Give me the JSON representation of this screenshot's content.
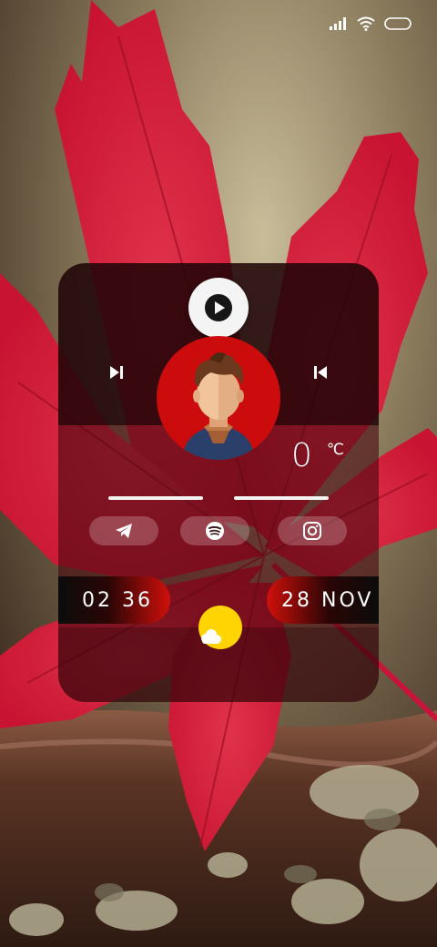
{
  "status_bar": {
    "icons": [
      "signal-icon",
      "wifi-icon",
      "battery-icon"
    ]
  },
  "music": {
    "play_icon": "play-icon",
    "next_icon": "skip-next-icon",
    "prev_icon": "skip-previous-icon"
  },
  "weather": {
    "temperature": "0",
    "unit": "℃",
    "icon": "sun-cloud-icon"
  },
  "social": [
    {
      "name": "telegram",
      "icon": "telegram-icon"
    },
    {
      "name": "spotify",
      "icon": "spotify-icon"
    },
    {
      "name": "instagram",
      "icon": "instagram-icon"
    }
  ],
  "clock": {
    "time": "02 36",
    "date": "28 NOV"
  },
  "colors": {
    "accent_red": "#cc0c0c",
    "sun_yellow": "#ffd400",
    "widget_dark": "#14040a"
  }
}
